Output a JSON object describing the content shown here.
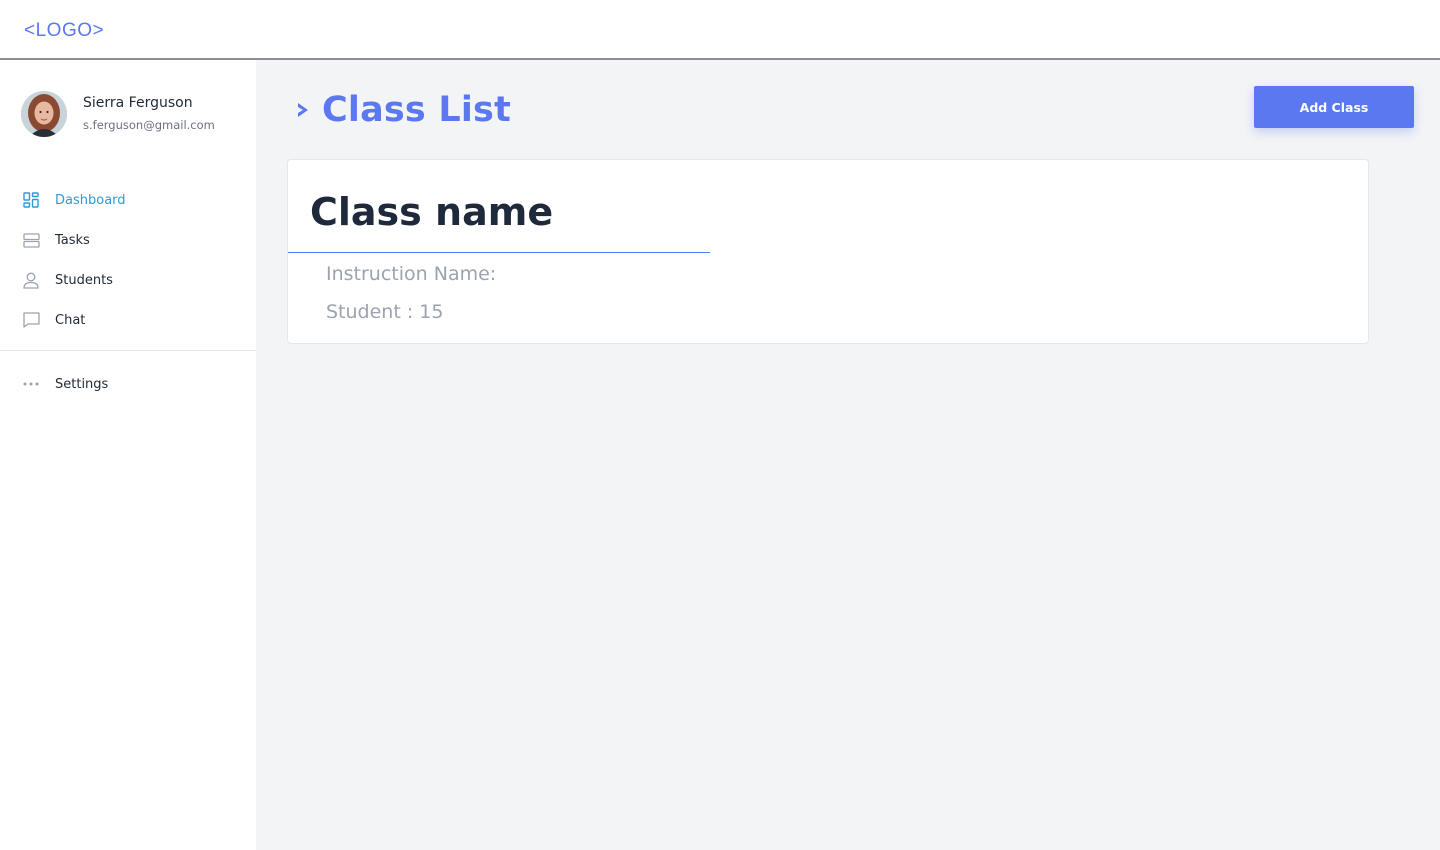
{
  "logo": "<LOGO>",
  "user": {
    "name": "Sierra Ferguson",
    "email": "s.ferguson@gmail.com"
  },
  "nav": {
    "items": [
      {
        "label": "Dashboard",
        "icon": "dashboard-icon",
        "active": true
      },
      {
        "label": "Tasks",
        "icon": "tasks-icon",
        "active": false
      },
      {
        "label": "Students",
        "icon": "user-icon",
        "active": false
      },
      {
        "label": "Chat",
        "icon": "chat-icon",
        "active": false
      }
    ],
    "settings": {
      "label": "Settings",
      "icon": "more-dots-icon"
    }
  },
  "main": {
    "title": "Class List",
    "add_button": "Add Class",
    "card": {
      "class_name": "Class name",
      "instructor_label": "Instruction Name:",
      "students_label": "Student : 15"
    }
  },
  "colors": {
    "accent": "#5b78f0",
    "active_nav": "#2f9ad8",
    "background": "#f3f4f6",
    "heading": "#1e293b"
  }
}
